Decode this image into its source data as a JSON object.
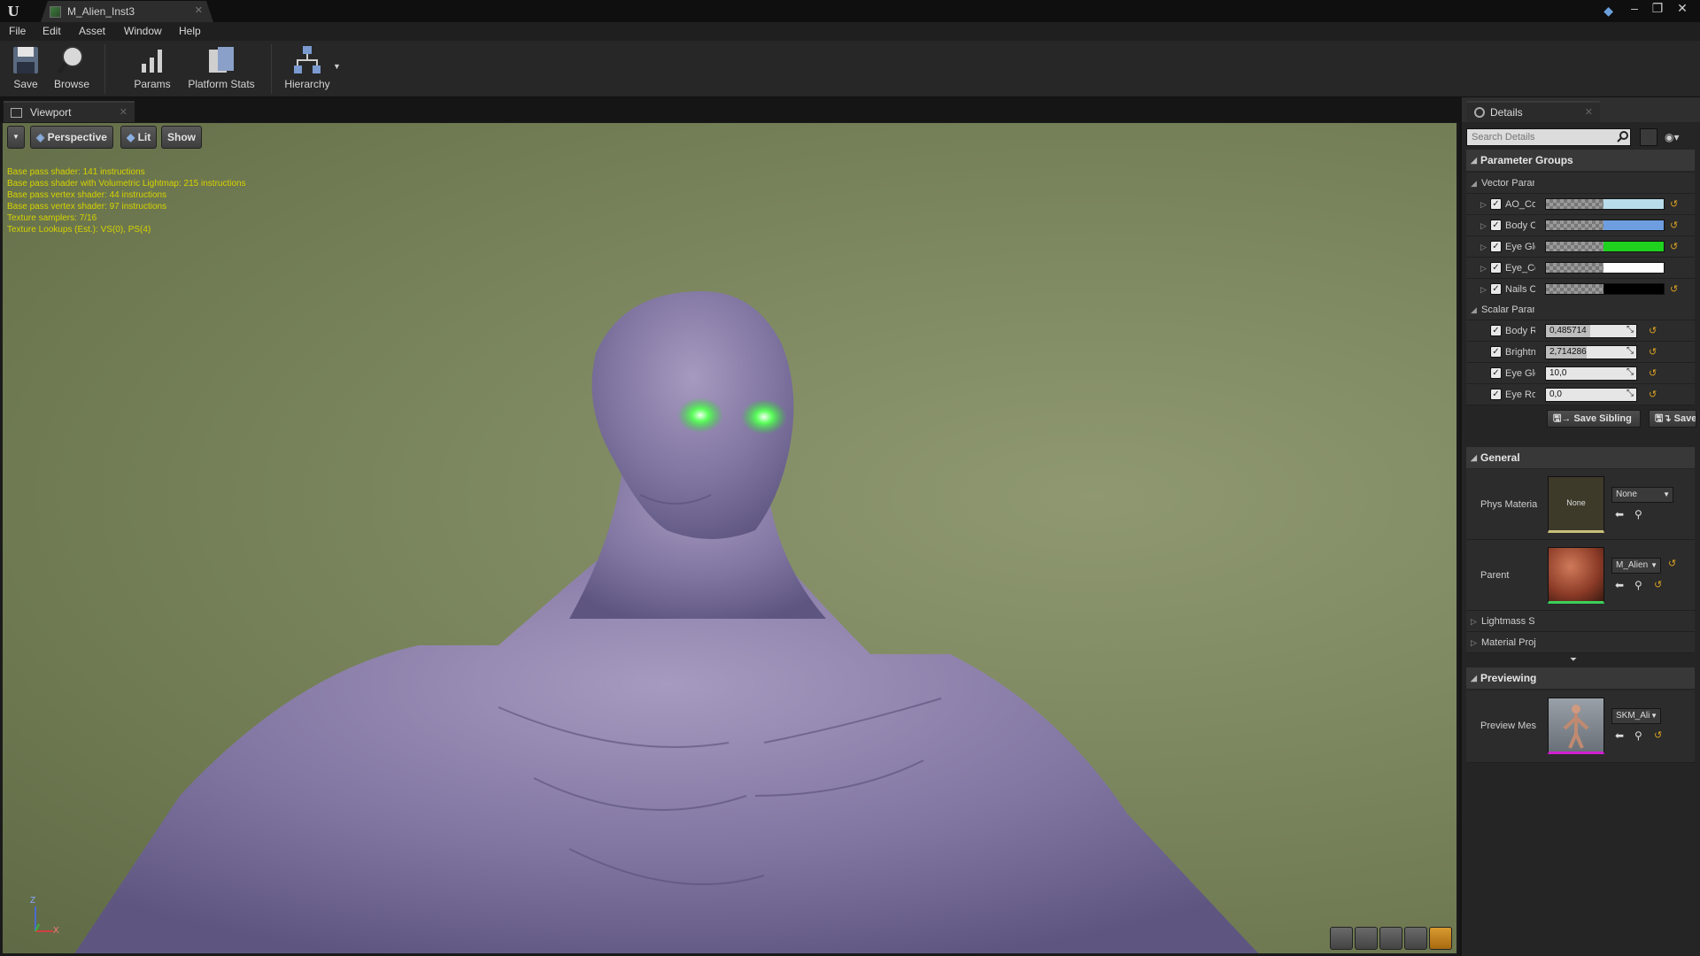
{
  "window": {
    "doc_tab_title": "M_Alien_Inst3",
    "logo": "U",
    "minimize": "–",
    "restore": "❐",
    "close": "✕"
  },
  "menu": [
    "File",
    "Edit",
    "Asset",
    "Window",
    "Help"
  ],
  "toolbar": {
    "save": "Save",
    "browse": "Browse",
    "params": "Params",
    "platform_stats": "Platform Stats",
    "hierarchy": "Hierarchy"
  },
  "viewport": {
    "tab_label": "Viewport",
    "perspective": "Perspective",
    "lit": "Lit",
    "show": "Show",
    "stats": [
      "Base pass shader: 141 instructions",
      "Base pass shader with Volumetric Lightmap: 215 instructions",
      "Base pass vertex shader: 44 instructions",
      "Base pass vertex shader: 97 instructions",
      "Texture samplers: 7/16",
      "Texture Lookups (Est.): VS(0), PS(4)"
    ],
    "axis_z": "Z",
    "axis_x": "X"
  },
  "details": {
    "tab_label": "Details",
    "search_placeholder": "Search Details",
    "parameter_groups": "Parameter Groups",
    "vector_params_label": "Vector Paran",
    "scalar_params_label": "Scalar Paran",
    "vector_params": [
      {
        "name": "AO_Colo",
        "color": "#b8dcea"
      },
      {
        "name": "Body Cc",
        "color": "#6e9ee0"
      },
      {
        "name": "Eye Glo",
        "color": "#1ed21e"
      },
      {
        "name": "Eye_Col",
        "color": "#ffffff"
      },
      {
        "name": "Nails Cc",
        "color": "#000000"
      }
    ],
    "scalar_params": [
      {
        "name": "Body Ro",
        "value": "0,485714",
        "fill": 0.49
      },
      {
        "name": "Brightne",
        "value": "2,714286",
        "fill": 0.45
      },
      {
        "name": "Eye Glov",
        "value": "10,0",
        "fill": 0
      },
      {
        "name": "Eye Rou",
        "value": "0,0",
        "fill": 0
      }
    ],
    "save_sibling": "Save Sibling",
    "save_child": "Save",
    "general": "General",
    "phys_material_label": "Phys Materia",
    "phys_material_thumb": "None",
    "phys_material_value": "None",
    "parent_label": "Parent",
    "parent_value": "M_Alien",
    "lightmass_label": "Lightmass S",
    "material_props_label": "Material Proj",
    "previewing": "Previewing",
    "preview_mesh_label": "Preview Mes",
    "preview_mesh_value": "SKM_Ali"
  }
}
